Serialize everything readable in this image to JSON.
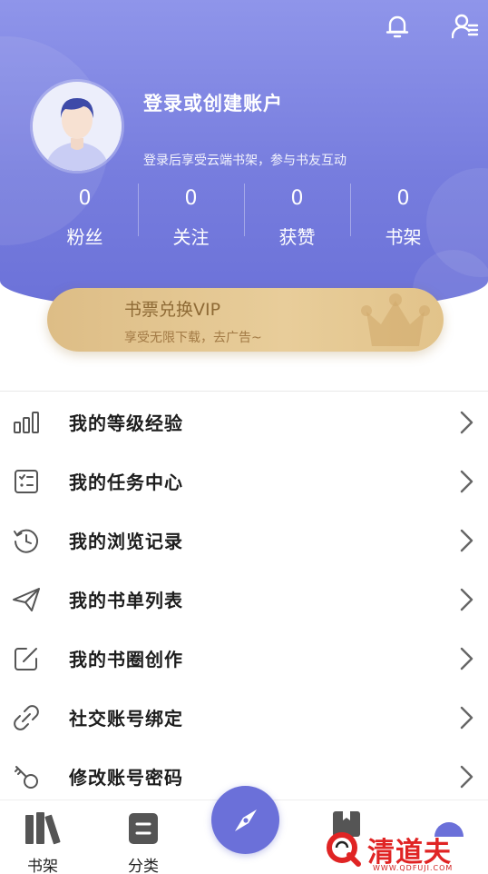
{
  "header": {
    "login_title": "登录或创建账户",
    "login_subtitle": "登录后享受云端书架，参与书友互动",
    "stats": [
      {
        "value": "0",
        "label": "粉丝"
      },
      {
        "value": "0",
        "label": "关注"
      },
      {
        "value": "0",
        "label": "获赞"
      },
      {
        "value": "0",
        "label": "书架"
      }
    ]
  },
  "vip": {
    "title": "书票兑换VIP",
    "subtitle": "享受无限下载，去广告~"
  },
  "menu": [
    {
      "label": "我的等级经验",
      "icon": "bar-chart-icon"
    },
    {
      "label": "我的任务中心",
      "icon": "task-list-icon"
    },
    {
      "label": "我的浏览记录",
      "icon": "history-clock-icon"
    },
    {
      "label": "我的书单列表",
      "icon": "paper-plane-icon"
    },
    {
      "label": "我的书圈创作",
      "icon": "edit-icon"
    },
    {
      "label": "社交账号绑定",
      "icon": "link-icon"
    },
    {
      "label": "修改账号密码",
      "icon": "key-icon"
    }
  ],
  "tabbar": {
    "shelf_label": "书架",
    "category_label": "分类"
  },
  "watermark": {
    "text": "清道夫",
    "url": "WWW.QDFUJI.COM"
  },
  "colors": {
    "header_primary": "#777dde",
    "vip_gold": "#e8cd9a",
    "accent": "#6b70d9",
    "watermark_red": "#e02424"
  }
}
